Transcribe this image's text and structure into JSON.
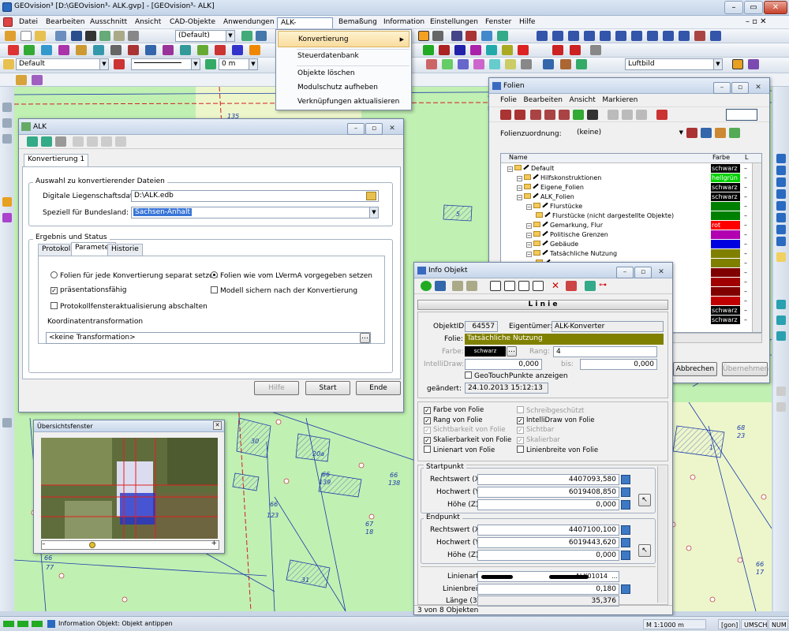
{
  "app": {
    "title": "GEOvision³  [D:\\GEOvision³- ALK.gvp] - [GEOvision³- ALK]",
    "controls": [
      "–",
      "▭",
      "✕"
    ]
  },
  "menu": {
    "items": [
      "Datei",
      "Bearbeiten",
      "Ausschnitt",
      "Ansicht",
      "CAD-Objekte",
      "Anwendungen",
      "ALK-Konverter",
      "Bemaßung",
      "Information",
      "Einstellungen",
      "Fenster",
      "Hilfe"
    ],
    "doc_controls": "– ▫ ✕"
  },
  "toolbar": {
    "view_dropdown": "(Default)",
    "layer_dropdown": "Default",
    "width_value": "0 m",
    "raster_dropdown": "Luftbild"
  },
  "alk_menu": {
    "items": [
      "Konvertierung",
      "Steuerdatenbank",
      "Objekte löschen",
      "Modulschutz aufheben",
      "Verknüpfungen aktualisieren"
    ],
    "submenu_arrow": "▶"
  },
  "alk_window": {
    "title": "ALK",
    "tab": "Konvertierung 1",
    "group_files": "Auswahl zu konvertierender Dateien",
    "label_data": "Digitale Liegenschaftsdaten:",
    "value_data": "D:\\ALK.edb",
    "label_state": "Speziell für Bundesland:",
    "value_state": "Sachsen-Anhalt",
    "group_result": "Ergebnis und Status",
    "tabs": [
      "Protokoll",
      "Parameter",
      "Historie"
    ],
    "opt_separate": "Folien für jede Konvertierung separat setzen",
    "opt_lvermA": "Folien wie vom LVermA vorgegeben setzen",
    "opt_presentation": "präsentationsfähig",
    "opt_save_model": "Modell sichern nach der Konvertierung",
    "opt_protocol": "Protokollfensteraktualisierung abschalten",
    "label_transform": "Koordinatentransformation",
    "value_transform": "<keine Transformation>",
    "btn_help": "Hilfe",
    "btn_start": "Start",
    "btn_end": "Ende"
  },
  "folien_window": {
    "title": "Folien",
    "menu": [
      "Folie",
      "Bearbeiten",
      "Ansicht",
      "Markieren"
    ],
    "assign_label": "Folienzuordnung:",
    "assign_value": "(keine)",
    "col_name": "Name",
    "col_color": "Farbe",
    "col_l": "L",
    "rows": [
      {
        "name": "Default",
        "indent": 0,
        "color": "schwarz",
        "hex": "#000000"
      },
      {
        "name": "Hilfskonstruktionen",
        "indent": 1,
        "color": "hellgrün",
        "hex": "#00d000"
      },
      {
        "name": "Eigene_Folien",
        "indent": 1,
        "color": "schwarz",
        "hex": "#000000"
      },
      {
        "name": "ALK_Folien",
        "indent": 1,
        "color": "schwarz",
        "hex": "#000000"
      },
      {
        "name": "Flurstücke",
        "indent": 2,
        "color": "",
        "hex": "#008000"
      },
      {
        "name": "Flurstücke (nicht dargestellte Objekte)",
        "indent": 3,
        "color": "",
        "hex": "#008000"
      },
      {
        "name": "Gemarkung, Flur",
        "indent": 2,
        "color": "rot",
        "hex": "#ff0000"
      },
      {
        "name": "Politische Grenzen",
        "indent": 2,
        "color": "",
        "hex": "#b000b0"
      },
      {
        "name": "Gebäude",
        "indent": 2,
        "color": "",
        "hex": "#0000e0"
      },
      {
        "name": "Tatsächliche Nutzung",
        "indent": 2,
        "color": "",
        "hex": "#808000"
      },
      {
        "name": "",
        "indent": 3,
        "color": "",
        "hex": "#808000"
      },
      {
        "name": "",
        "indent": 3,
        "color": "",
        "hex": "#800000"
      },
      {
        "name": "",
        "indent": 3,
        "color": "",
        "hex": "#a00000"
      },
      {
        "name": "",
        "indent": 3,
        "color": "",
        "hex": "#800000"
      },
      {
        "name": "",
        "indent": 3,
        "color": "",
        "hex": "#c00000"
      },
      {
        "name": "",
        "indent": 3,
        "color": "schwarz",
        "hex": "#000000"
      },
      {
        "name": "",
        "indent": 3,
        "color": "schwarz",
        "hex": "#000000"
      }
    ],
    "overflow_text": "Objek...",
    "btn_cancel": "Abbrechen",
    "btn_apply": "Übernehmen"
  },
  "info_window": {
    "title": "Info Objekt",
    "type": "L i n i e",
    "label_id": "ObjektID:",
    "value_id": "64557",
    "label_owner": "Eigentümer:",
    "value_owner": "ALK-Konverter",
    "label_layer": "Folie:",
    "value_layer": "Tatsächliche Nutzung",
    "label_color": "Farbe:",
    "value_color": "schwarz",
    "label_rank": "Rang:",
    "value_rank": "4",
    "label_intelli": "IntelliDraw:",
    "value_intelli": "0,000",
    "label_to": "bis:",
    "value_to": "0,000",
    "geotouch": "GeoTouchPunkte anzeigen",
    "label_changed": "geändert:",
    "value_changed": "24.10.2013 15:12:13",
    "checks": [
      {
        "label": "Farbe von Folie",
        "checked": true,
        "enabled": true
      },
      {
        "label": "Schreibgeschützt",
        "checked": false,
        "enabled": false
      },
      {
        "label": "Rang von Folie",
        "checked": true,
        "enabled": true
      },
      {
        "label": "IntelliDraw von Folie",
        "checked": true,
        "enabled": true
      },
      {
        "label": "Sichtbarkeit von Folie",
        "checked": true,
        "enabled": false
      },
      {
        "label": "Sichtbar",
        "checked": true,
        "enabled": false
      },
      {
        "label": "Skalierbarkeit von Folie",
        "checked": true,
        "enabled": true
      },
      {
        "label": "Skalierbar",
        "checked": true,
        "enabled": false
      },
      {
        "label": "Linienart von Folie",
        "checked": false,
        "enabled": true
      },
      {
        "label": "Linienbreite von Folie",
        "checked": false,
        "enabled": true
      }
    ],
    "group_start": "Startpunkt",
    "group_end": "Endpunkt",
    "label_rw": "Rechtswert (X):",
    "label_hw": "Hochwert (Y):",
    "label_z": "Höhe (Z):",
    "start_rw": "4407093,580",
    "start_hw": "6019408,850",
    "start_z": "0,000",
    "end_rw": "4407100,100",
    "end_hw": "6019443,620",
    "end_z": "0,000",
    "label_linetype": "Linienart:",
    "value_linetype": "ALK01014",
    "label_linewidth": "Linienbreite:",
    "value_linewidth": "0,180",
    "label_length": "Länge (3D):",
    "value_length": "35,376",
    "status": "3 von 8 Objekten"
  },
  "overview": {
    "title": "Übersichtsfenster"
  },
  "map": {
    "labels": [
      "64557",
      "66",
      "138",
      "66",
      "139",
      "67",
      "18",
      "66",
      "123",
      "66",
      "77",
      "30",
      "31",
      "63",
      "89",
      "20a",
      "1",
      "25",
      "68",
      "23",
      "66",
      "17",
      "135",
      "79",
      "92",
      "5",
      "117",
      "51",
      "92",
      "115"
    ]
  },
  "status": {
    "text": "Information Objekt: Objekt antippen",
    "scale": "M 1:1000  m",
    "unit": "[gon]",
    "umsch": "UMSCH",
    "num": "NUM"
  }
}
